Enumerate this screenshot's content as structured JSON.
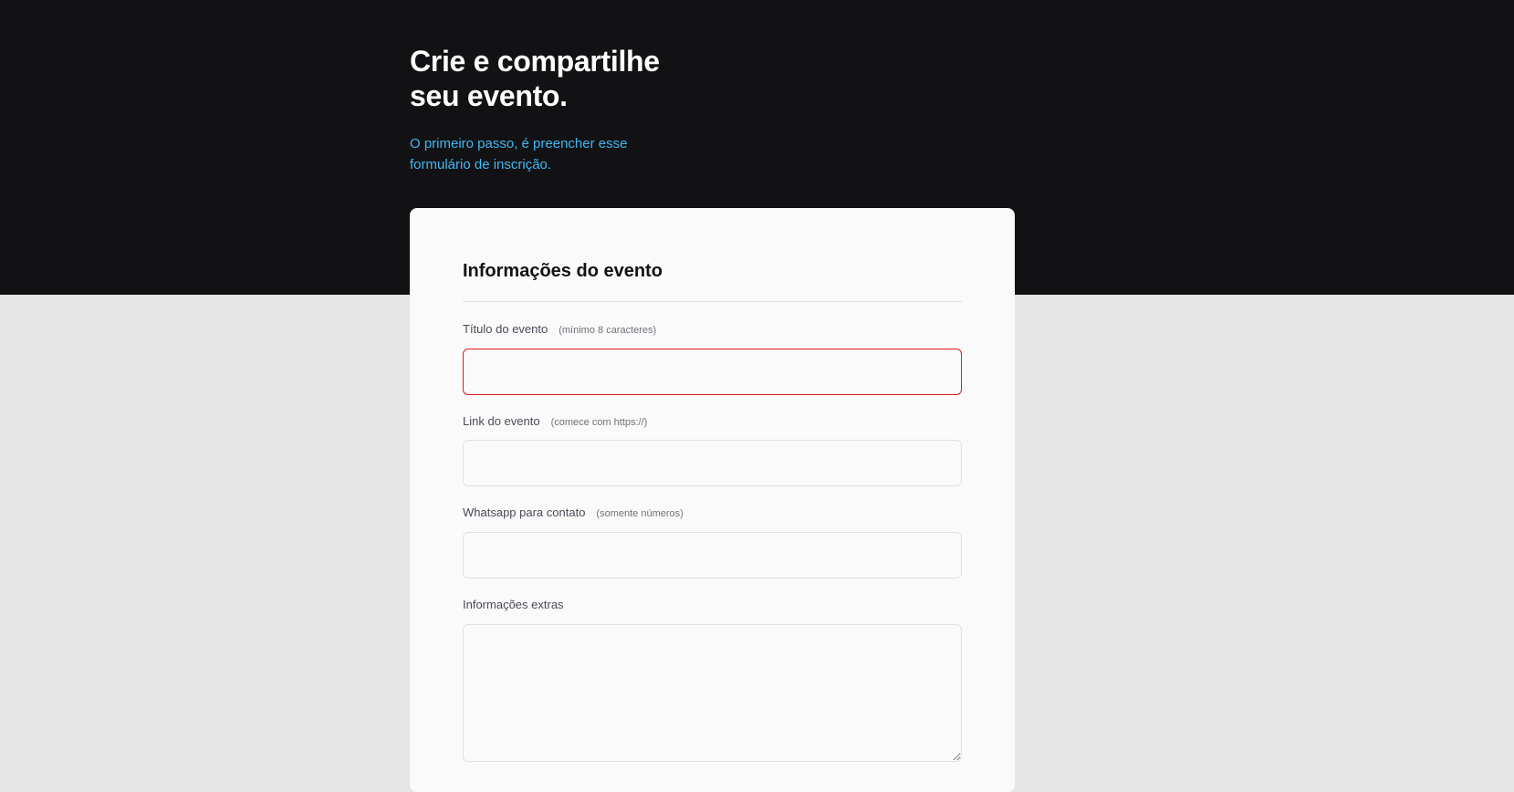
{
  "hero": {
    "title_line1": "Crie e compartilhe",
    "title_line2": "seu evento.",
    "subtitle_line1": "O primeiro passo, é preencher esse",
    "subtitle_line2": "formulário de inscrição."
  },
  "form": {
    "section_title": "Informações do evento",
    "fields": [
      {
        "label": "Título do evento",
        "hint": "(mínimo 8 caracteres)",
        "value": "",
        "state": "invalid"
      },
      {
        "label": "Link do evento",
        "hint": "(comece com https://)",
        "value": ""
      },
      {
        "label": "Whatsapp para contato",
        "hint": "(somente números)",
        "value": ""
      },
      {
        "label": "Informações extras",
        "value": ""
      }
    ]
  },
  "colors": {
    "hero_background": "#121214",
    "page_background": "#e5e5e5",
    "card_background": "#fafafa",
    "accent": "#41b7f4",
    "error_border": "#e31a1a"
  }
}
